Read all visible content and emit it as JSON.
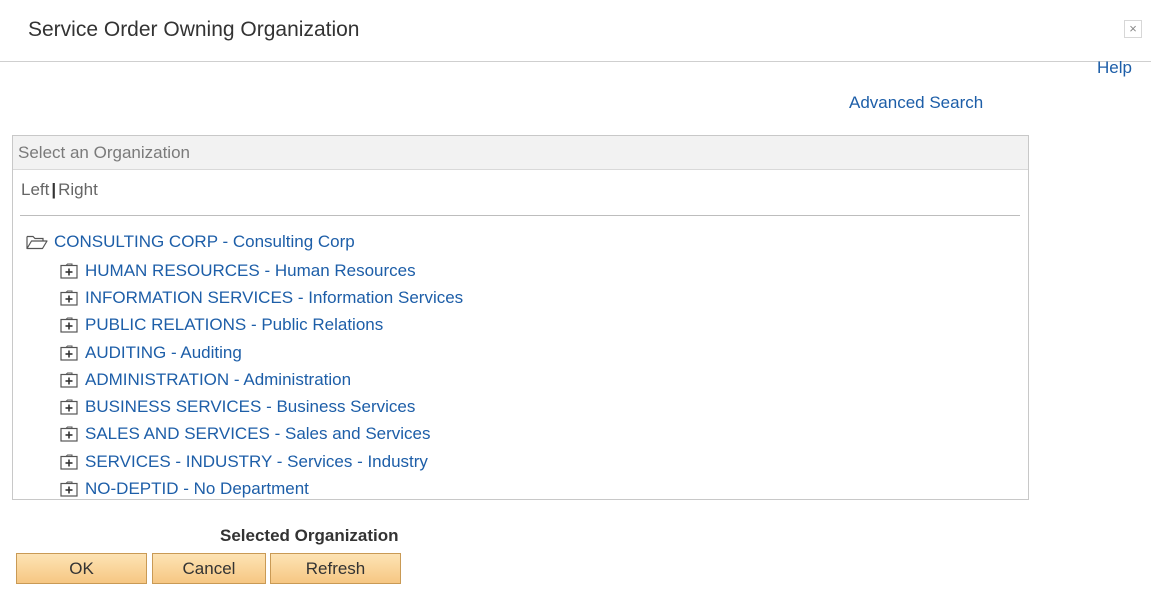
{
  "dialog": {
    "title": "Service Order Owning Organization",
    "close_glyph": "×"
  },
  "links": {
    "help": "Help",
    "advanced_search": "Advanced Search"
  },
  "tree_panel": {
    "header": "Select an Organization",
    "orientation": {
      "left": "Left",
      "separator": "|",
      "right": "Right"
    },
    "root": {
      "label": "CONSULTING CORP - Consulting Corp",
      "icon": "open-folder-icon"
    },
    "children": [
      {
        "label": "HUMAN RESOURCES - Human Resources"
      },
      {
        "label": "INFORMATION SERVICES - Information Services"
      },
      {
        "label": "PUBLIC RELATIONS - Public Relations"
      },
      {
        "label": "AUDITING - Auditing"
      },
      {
        "label": "ADMINISTRATION - Administration"
      },
      {
        "label": "BUSINESS SERVICES - Business Services"
      },
      {
        "label": "SALES AND SERVICES - Sales and Services"
      },
      {
        "label": "SERVICES - INDUSTRY - Services - Industry"
      },
      {
        "label": "NO-DEPTID - No Department"
      }
    ],
    "child_icon": "expand-folder-icon"
  },
  "selected_organization": {
    "label": "Selected Organization"
  },
  "buttons": {
    "ok": "OK",
    "cancel": "Cancel",
    "refresh": "Refresh"
  },
  "colors": {
    "link": "#1d5ea8",
    "button_top": "#fde3b4",
    "button_bottom": "#f6c783",
    "button_border": "#c99a55",
    "panel_header_bg": "#f2f2f2"
  }
}
